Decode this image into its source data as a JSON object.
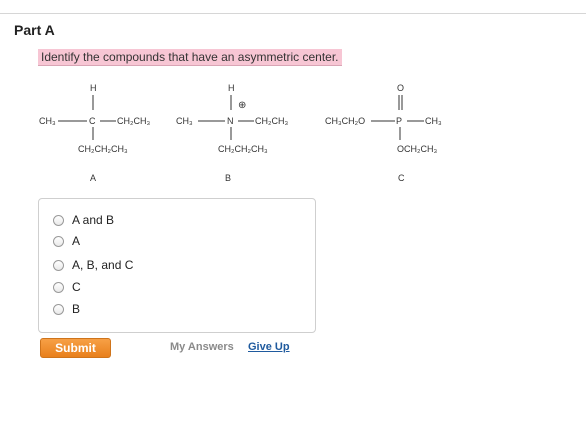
{
  "part": {
    "title": "Part A"
  },
  "question": {
    "text": "Identify the compounds that have an asymmetric center."
  },
  "structures": {
    "a": {
      "top": "H",
      "left": "CH₃",
      "center": "C",
      "right": "CH₂CH₃",
      "bottom": "CH₂CH₂CH₃",
      "letter": "A"
    },
    "b": {
      "top": "H",
      "charge": "⊕",
      "left": "CH₃",
      "center": "N",
      "right": "CH₂CH₃",
      "bottom": "CH₂CH₂CH₃",
      "letter": "B"
    },
    "c": {
      "top": "O",
      "left": "CH₃CH₂O",
      "center": "P",
      "right": "CH₃",
      "bottom": "OCH₂CH₃",
      "letter": "C"
    }
  },
  "answers": {
    "options": [
      "A and B",
      "A",
      "A, B, and C",
      "C",
      "B"
    ]
  },
  "actions": {
    "submit": "Submit",
    "my_answers": "My Answers",
    "give_up": "Give Up"
  }
}
